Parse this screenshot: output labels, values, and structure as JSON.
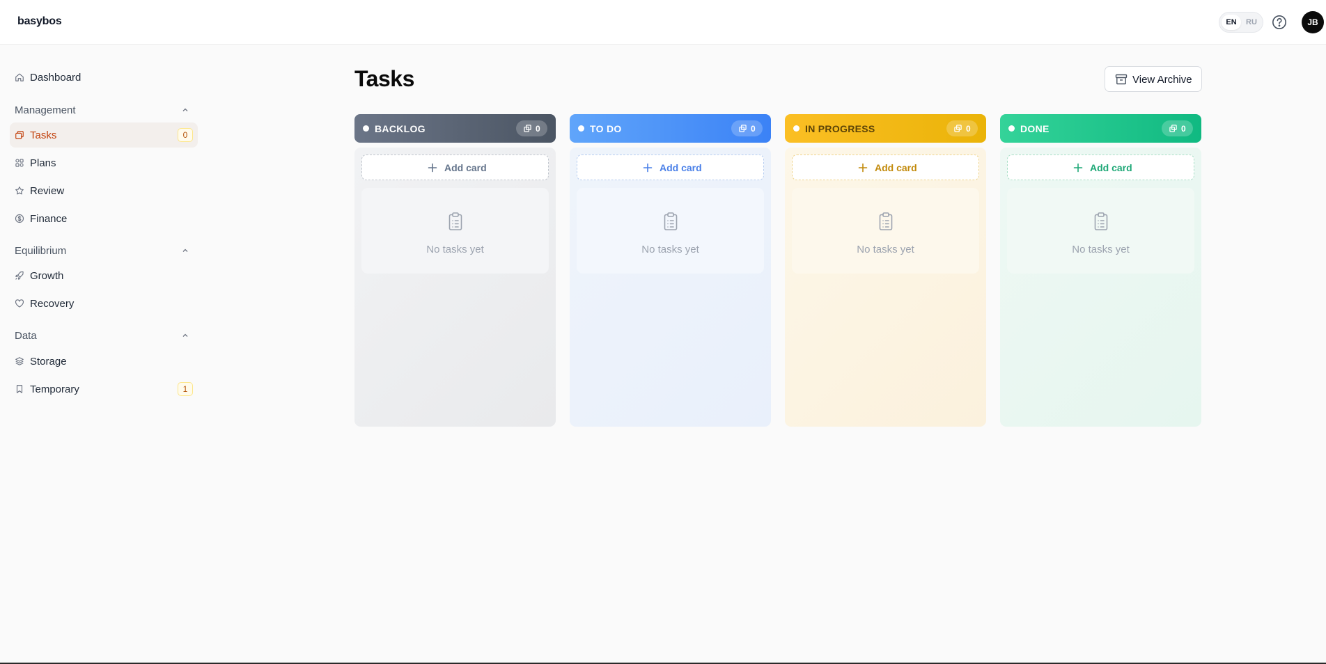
{
  "app": {
    "logo": "basybos"
  },
  "header": {
    "languages": [
      "EN",
      "RU"
    ],
    "active_language": "EN",
    "help_icon": "question-circle-icon",
    "avatar_initials": "JB"
  },
  "sidebar": {
    "dashboard": {
      "label": "Dashboard",
      "icon": "home-icon"
    },
    "sections": [
      {
        "title": "Management",
        "items": [
          {
            "label": "Tasks",
            "icon": "copy-stack-icon",
            "badge": "0",
            "active": true
          },
          {
            "label": "Plans",
            "icon": "grid-icon"
          },
          {
            "label": "Review",
            "icon": "star-icon"
          },
          {
            "label": "Finance",
            "icon": "dollar-circle-icon"
          }
        ]
      },
      {
        "title": "Equilibrium",
        "items": [
          {
            "label": "Growth",
            "icon": "rocket-icon"
          },
          {
            "label": "Recovery",
            "icon": "heart-icon"
          }
        ]
      },
      {
        "title": "Data",
        "items": [
          {
            "label": "Storage",
            "icon": "layers-icon"
          },
          {
            "label": "Temporary",
            "icon": "bookmark-icon",
            "badge": "1"
          }
        ]
      }
    ]
  },
  "main": {
    "title": "Tasks",
    "archive_button": "View Archive",
    "columns": [
      {
        "name": "BACKLOG",
        "count": "0",
        "add_label": "Add card",
        "empty_text": "No tasks yet",
        "color": "#4b5563"
      },
      {
        "name": "TO DO",
        "count": "0",
        "add_label": "Add card",
        "empty_text": "No tasks yet",
        "color": "#3b82f6"
      },
      {
        "name": "IN PROGRESS",
        "count": "0",
        "add_label": "Add card",
        "empty_text": "No tasks yet",
        "color": "#eab308"
      },
      {
        "name": "DONE",
        "count": "0",
        "add_label": "Add card",
        "empty_text": "No tasks yet",
        "color": "#10b981"
      }
    ]
  },
  "theme": {
    "accent": "#c2410c",
    "badge_bg": "#fffbeb",
    "badge_border": "#fde68a"
  }
}
